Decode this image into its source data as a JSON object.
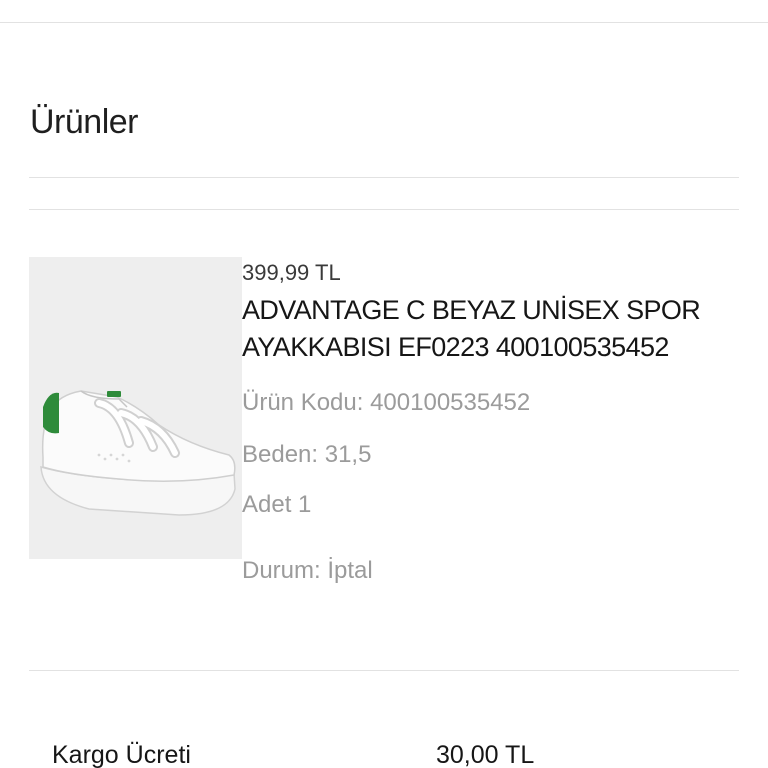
{
  "section": {
    "title": "Ürünler"
  },
  "product": {
    "image_icon": "sneaker-image",
    "price": "399,99 TL",
    "name": "ADVANTAGE C BEYAZ UNİSEX SPOR AYAKKABISI EF0223 400100535452",
    "code": "Ürün Kodu: 400100535452",
    "size": "Beden: 31,5",
    "quantity": "Adet 1",
    "status": "Durum: İptal"
  },
  "summary": {
    "shipping_label": "Kargo Ücreti",
    "shipping_value": "30,00 TL"
  },
  "colors": {
    "divider": "#e2e2e2",
    "muted_text": "#9b9b9b",
    "image_bg": "#eeeeee",
    "accent_green": "#2e8b3a"
  }
}
